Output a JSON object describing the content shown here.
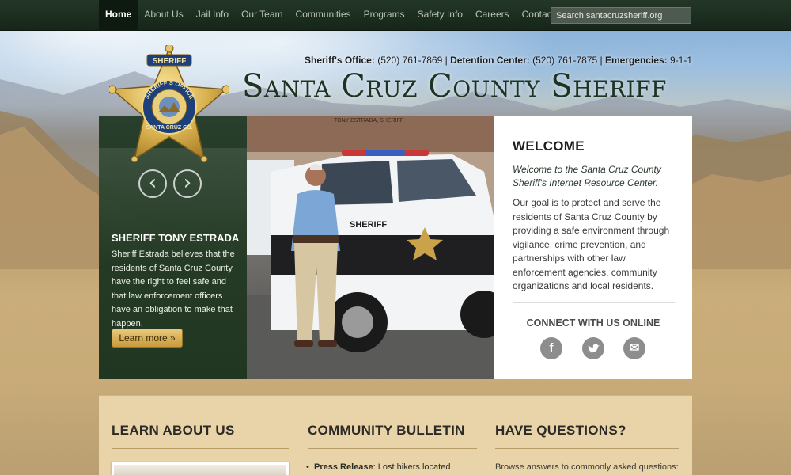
{
  "nav": {
    "items": [
      "Home",
      "About Us",
      "Jail Info",
      "Our Team",
      "Communities",
      "Programs",
      "Safety Info",
      "Careers",
      "Contact Us"
    ],
    "active": "Home",
    "search_placeholder": "Search santacruzsheriff.org"
  },
  "header": {
    "sheriff_office_label": "Sheriff's Office:",
    "sheriff_office_phone": "(520) 761-7869",
    "detention_label": "Detention Center:",
    "detention_phone": "(520) 761-7875",
    "emergencies_label": "Emergencies:",
    "emergencies_phone": "9-1-1",
    "title": "Santa Cruz County Sheriff",
    "badge_top_text": "SHERIFF",
    "badge_ring_text": "SHERIFF'S OFFICE",
    "badge_bottom_text": "SANTA CRUZ CO."
  },
  "hero": {
    "prev_glyph": "‹",
    "next_glyph": "›",
    "heading": "SHERIFF TONY ESTRADA",
    "description": "Sheriff Estrada believes that the residents of Santa Cruz County have the right to feel safe and that law enforcement officers have an obligation to make that happen.",
    "button": "Learn more »",
    "photo_sign": "TONY ESTRADA, SHERIFF",
    "vehicle_text": "SHERIFF"
  },
  "welcome": {
    "title": "WELCOME",
    "intro": "Welcome to the Santa Cruz County Sheriff's Internet Resource Center.",
    "body": "Our goal is to protect and serve the residents of Santa Cruz County by providing a safe environment through vigilance, crime prevention, and partnerships with other law enforcement agencies, community organizations and local residents.",
    "connect_title": "CONNECT WITH US ONLINE",
    "social_icons": [
      "facebook-icon",
      "twitter-icon",
      "email-icon"
    ],
    "social_glyphs": [
      "f",
      "🐦",
      "✉"
    ]
  },
  "bottom": {
    "learn_title": "LEARN ABOUT US",
    "bulletin_title": "COMMUNITY BULLETIN",
    "questions_title": "HAVE QUESTIONS?",
    "bulletin_item_label": "Press Release",
    "bulletin_item_text": ": Lost hikers located",
    "questions_text": "Browse answers to commonly asked questions:"
  },
  "colors": {
    "nav_bg": "#1b2d1e",
    "title_green": "#1f3322",
    "panel_tan": "#e8d4a8",
    "button_gold": "#d9b45a"
  }
}
